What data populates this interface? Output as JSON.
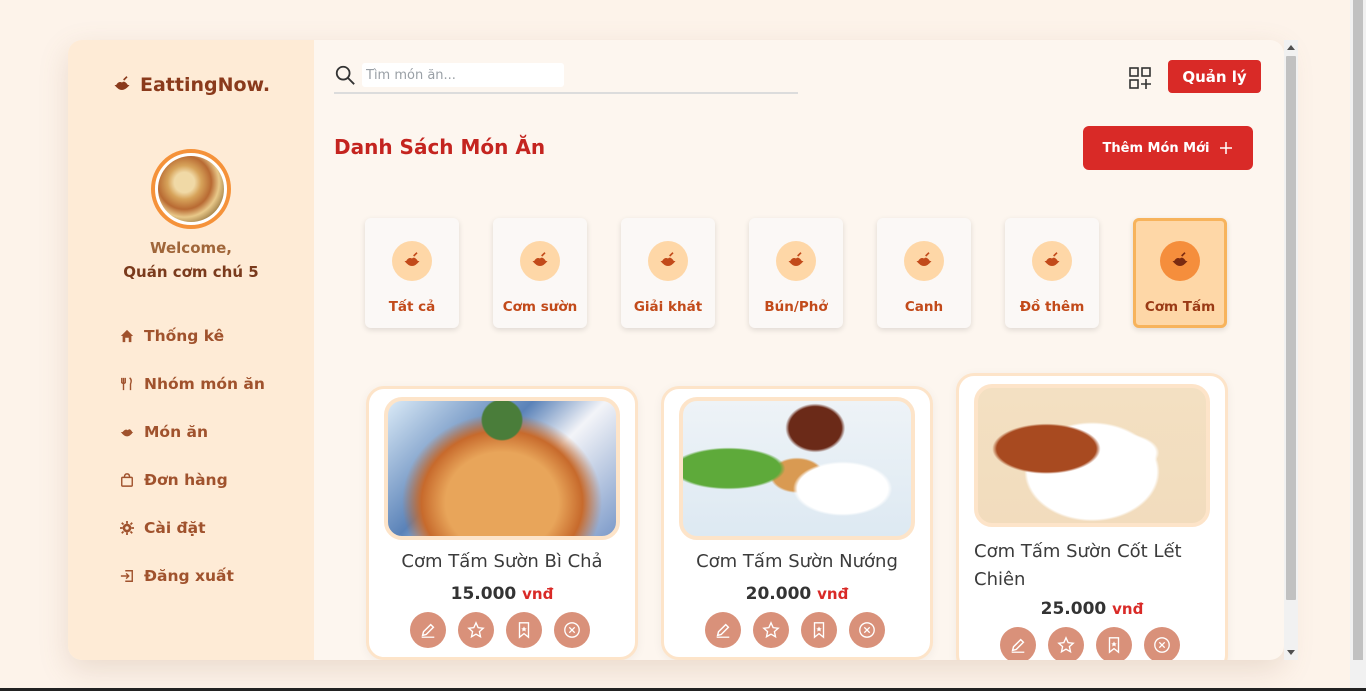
{
  "brand": {
    "name": "EattingNow."
  },
  "user": {
    "welcome": "Welcome,",
    "shop_name": "Quán cơm chú 5"
  },
  "menu": [
    {
      "label": "Thống kê",
      "icon": "home-icon"
    },
    {
      "label": "Nhóm món ăn",
      "icon": "utensils-icon"
    },
    {
      "label": "Món ăn",
      "icon": "bowl-icon"
    },
    {
      "label": "Đơn hàng",
      "icon": "bag-icon"
    },
    {
      "label": "Cài đặt",
      "icon": "gear-icon"
    },
    {
      "label": "Đăng xuất",
      "icon": "logout-icon"
    }
  ],
  "search": {
    "placeholder": "Tìm món ăn..."
  },
  "header": {
    "manage_label": "Quản lý"
  },
  "page": {
    "title": "Danh Sách Món Ăn",
    "add_label": "Thêm Món Mới"
  },
  "categories": [
    {
      "label": "Tất cả"
    },
    {
      "label": "Cơm sườn"
    },
    {
      "label": "Giải khát"
    },
    {
      "label": "Bún/Phở"
    },
    {
      "label": "Canh"
    },
    {
      "label": "Đồ thêm"
    },
    {
      "label": "Cơm Tấm",
      "active": true
    }
  ],
  "dishes": [
    {
      "name": "Cơm Tấm Sườn Bì Chả",
      "price": "15.000",
      "unit": "vnđ"
    },
    {
      "name": "Cơm Tấm Sườn Nướng",
      "price": "20.000",
      "unit": "vnđ"
    },
    {
      "name_line1": "Cơm Tấm Sườn Cốt Lết",
      "name_line2": "Chiên",
      "price": "25.000",
      "unit": "vnđ"
    }
  ],
  "colors": {
    "primary": "#d92a27",
    "sidebar": "#feebd6",
    "accent": "#f58e3c"
  }
}
